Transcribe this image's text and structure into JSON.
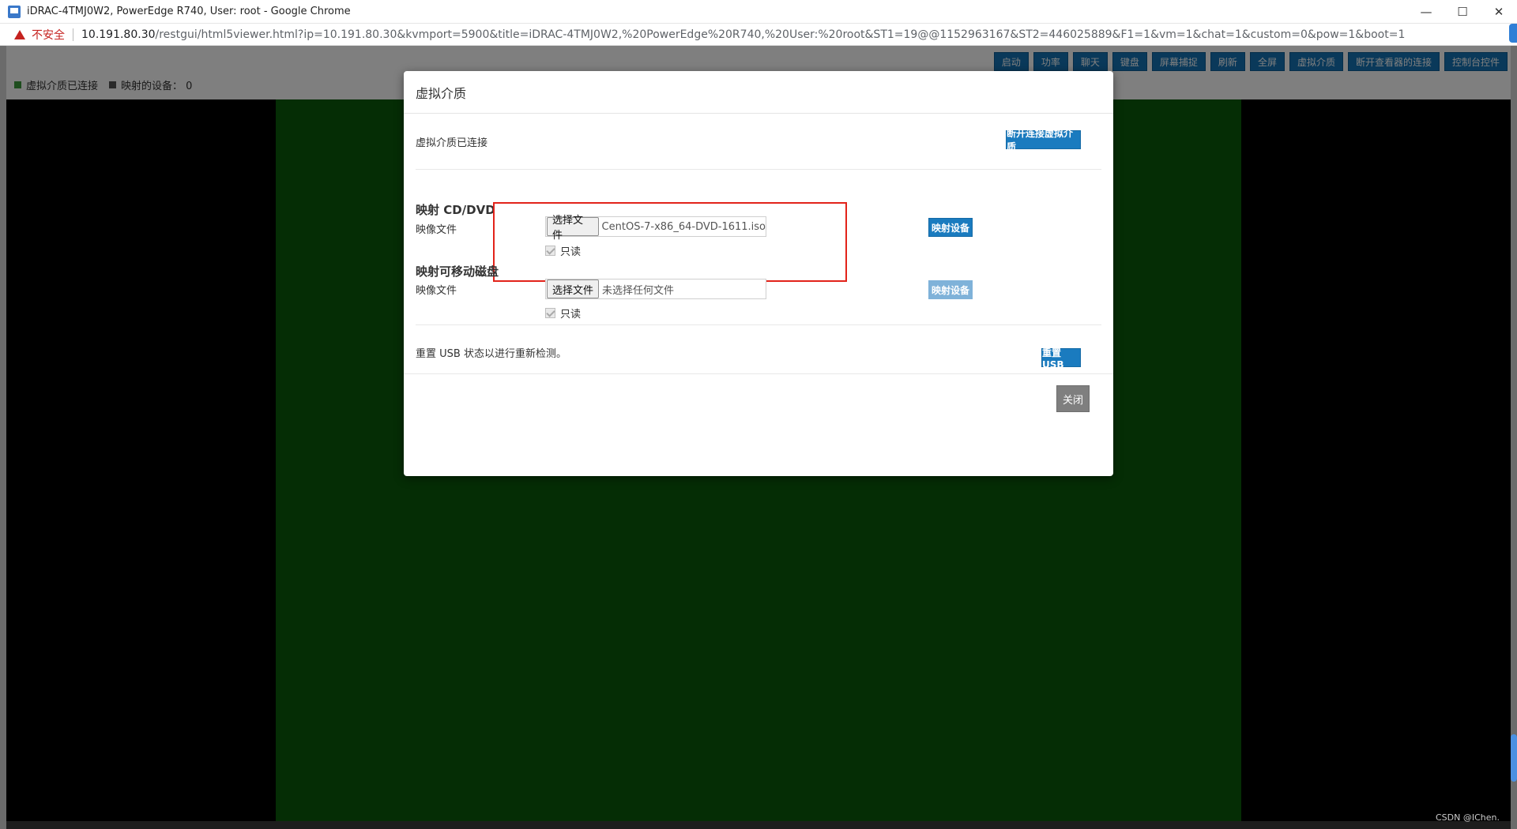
{
  "window": {
    "title": "iDRAC-4TMJ0W2, PowerEdge R740, User: root - Google Chrome",
    "controls": [
      "—",
      "☐",
      "✕"
    ]
  },
  "address": {
    "security_label": "不安全",
    "url_host": "10.191.80.30",
    "url_rest": "/restgui/html5viewer.html?ip=10.191.80.30&kvmport=5900&title=iDRAC-4TMJ0W2,%20PowerEdge%20R740,%20User:%20root&ST1=19@@1152963167&ST2=446025889&F1=1&vm=1&chat=1&custom=0&pow=1&boot=1"
  },
  "status": {
    "vm_connected": "虚拟介质已连接",
    "mapped_devices": "映射的设备： 0"
  },
  "toolbar": {
    "buttons": [
      "启动",
      "功率",
      "聊天",
      "键盘",
      "屏幕捕捉",
      "刷新",
      "全屏",
      "虚拟介质",
      "断开查看器的连接",
      "控制台控件"
    ]
  },
  "modal": {
    "title": "虚拟介质",
    "connected_text": "虚拟介质已连接",
    "disconnect_button": "断开连接虚拟介质",
    "cd": {
      "title": "映射 CD/DVD",
      "image_label": "映像文件",
      "choose_button": "选择文件",
      "file_name": "CentOS-7-x86_64-DVD-1611.iso",
      "readonly_label": "只读",
      "map_button": "映射设备"
    },
    "removable": {
      "title": "映射可移动磁盘",
      "image_label": "映像文件",
      "choose_button": "选择文件",
      "file_name": "未选择任何文件",
      "readonly_label": "只读",
      "map_button": "映射设备"
    },
    "usb": {
      "text": "重置 USB 状态以进行重新检测。",
      "button": "重置 USB"
    },
    "close_button": "关闭"
  },
  "watermark": "CSDN @IChen.",
  "colors": {
    "primary_button": "#1a7bbf",
    "highlight_box": "#e2231a",
    "console_screen": "#0a5a0a"
  }
}
